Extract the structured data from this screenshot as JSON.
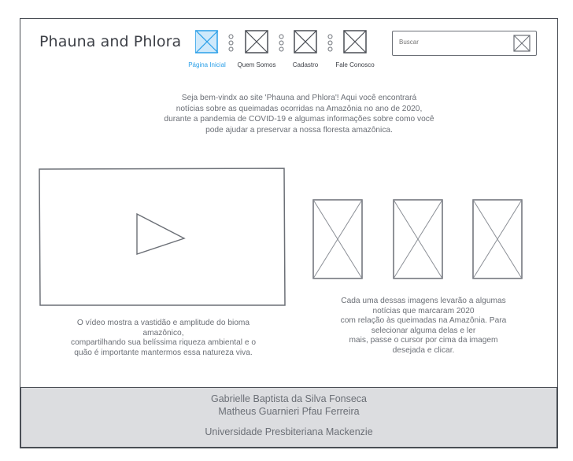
{
  "site": {
    "title": "Phauna and Phlora"
  },
  "nav": {
    "items": [
      {
        "label": "Página Inicial",
        "active": true
      },
      {
        "label": "Quem Somos",
        "active": false
      },
      {
        "label": "Cadastro",
        "active": false
      },
      {
        "label": "Fale Conosco",
        "active": false
      }
    ]
  },
  "search": {
    "placeholder": "Buscar",
    "button_icon": "image-placeholder-icon"
  },
  "intro": {
    "lines": [
      "Seja bem-vindx ao site 'Phauna and Phlora'! Aqui você encontrará",
      "notícias sobre as queimadas ocorridas na Amazônia no ano de 2020,",
      "durante a pandemia de COVID-19 e algumas informações sobre como você",
      "pode ajudar a preservar a nossa floresta amazônica."
    ]
  },
  "video": {
    "icon": "play-icon",
    "caption_lines": [
      "O vídeo mostra a vastidão e amplitude do bioma",
      "amazônico,",
      "compartilhando sua belíssima riqueza ambiental e o",
      "quão é importante mantermos essa natureza viva."
    ]
  },
  "news_images": {
    "count": 3,
    "icon": "image-placeholder-icon",
    "caption_lines": [
      "Cada uma dessas imagens levarão a algumas",
      "notícias que marcaram 2020",
      "com relação às queimadas na Amazônia. Para",
      "selecionar alguma delas e ler",
      "mais, passe o cursor por cima da imagem",
      "desejada e clicar."
    ]
  },
  "footer": {
    "authors": [
      "Gabrielle Baptista da Silva Fonseca",
      "Matheus Guarnieri Pfau Ferreira"
    ],
    "institution": "Universidade Presbiteriana Mackenzie"
  },
  "colors": {
    "active": "#2a9fe8",
    "active_fill": "#cfe9fb",
    "stroke": "#4a4e55",
    "footer_bg": "#dcdde0"
  }
}
